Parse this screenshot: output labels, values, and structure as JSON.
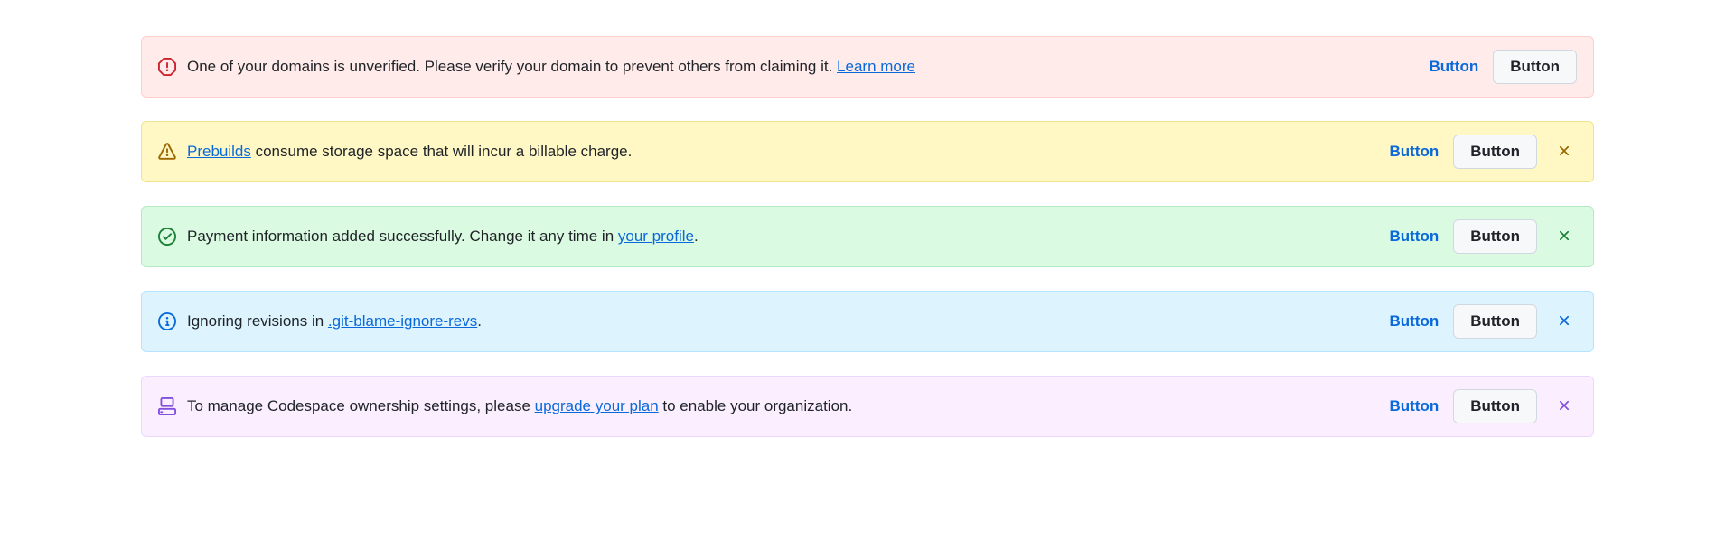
{
  "banners": [
    {
      "variant": "critical",
      "icon": "stop-icon",
      "text_before": "One of your domains is unverified. Please verify your domain to prevent others from claiming it. ",
      "link_text": "Learn more",
      "text_after": "",
      "primary_button": "Button",
      "secondary_button": "Button",
      "dismissible": false
    },
    {
      "variant": "warning",
      "icon": "alert-triangle-icon",
      "text_before": "",
      "link_text": "Prebuilds",
      "text_after": " consume storage space that will incur a billable charge.",
      "primary_button": "Button",
      "secondary_button": "Button",
      "dismissible": true
    },
    {
      "variant": "success",
      "icon": "check-circle-icon",
      "text_before": "Payment information added successfully. Change it any time in ",
      "link_text": "your profile",
      "text_after": ".",
      "primary_button": "Button",
      "secondary_button": "Button",
      "dismissible": true
    },
    {
      "variant": "info",
      "icon": "info-icon",
      "text_before": "Ignoring revisions in ",
      "link_text": ".git-blame-ignore-revs",
      "text_after": ".",
      "primary_button": "Button",
      "secondary_button": "Button",
      "dismissible": true
    },
    {
      "variant": "upsell",
      "icon": "codespaces-icon",
      "text_before": "To manage Codespace ownership settings, please ",
      "link_text": "upgrade your plan",
      "text_after": " to enable your organization.",
      "primary_button": "Button",
      "secondary_button": "Button",
      "dismissible": true
    }
  ]
}
